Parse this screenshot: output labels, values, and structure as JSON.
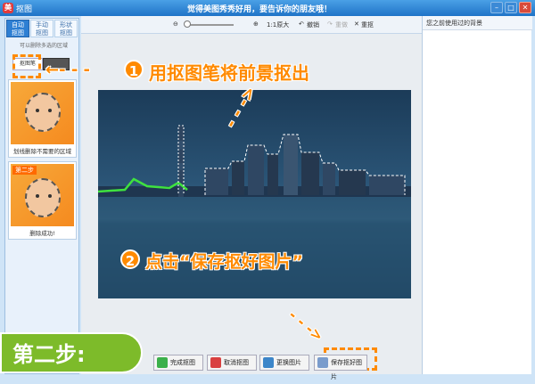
{
  "window": {
    "app_title": "抠图",
    "center_title": "觉得美图秀秀好用，要告诉你的朋友哦！"
  },
  "left_panel": {
    "tabs": [
      {
        "label": "自动\n抠图",
        "active": true
      },
      {
        "label": "手动\n抠图",
        "active": false
      },
      {
        "label": "形状\n抠图",
        "active": false
      }
    ],
    "hint": "可以删除多选的区域",
    "pen_button": "抠图笔",
    "cards": [
      {
        "caption": "划线删除不需要的区域"
      },
      {
        "step_badge": "第二步",
        "caption": "删除成功!"
      }
    ]
  },
  "toolbar": {
    "scale_label": "1:1原大",
    "undo_label": "撤销",
    "redo_label": "重做",
    "reset_label": "重抠"
  },
  "annotations": {
    "step1_number": "1",
    "step1_text": "用抠图笔将前景抠出",
    "step2_number": "2",
    "step2_text": "点击“保存抠好图片”",
    "step_label": "第二步:"
  },
  "bottom_buttons": {
    "finish": "完成抠图",
    "cancel": "取消抠图",
    "replace": "更换图片",
    "save": "保存抠好图片"
  },
  "right_panel": {
    "header": "您之前使用过的背景"
  },
  "colors": {
    "accent": "#ff8a00",
    "step_green": "#7dbb2a",
    "title_blue": "#1f73c7"
  }
}
